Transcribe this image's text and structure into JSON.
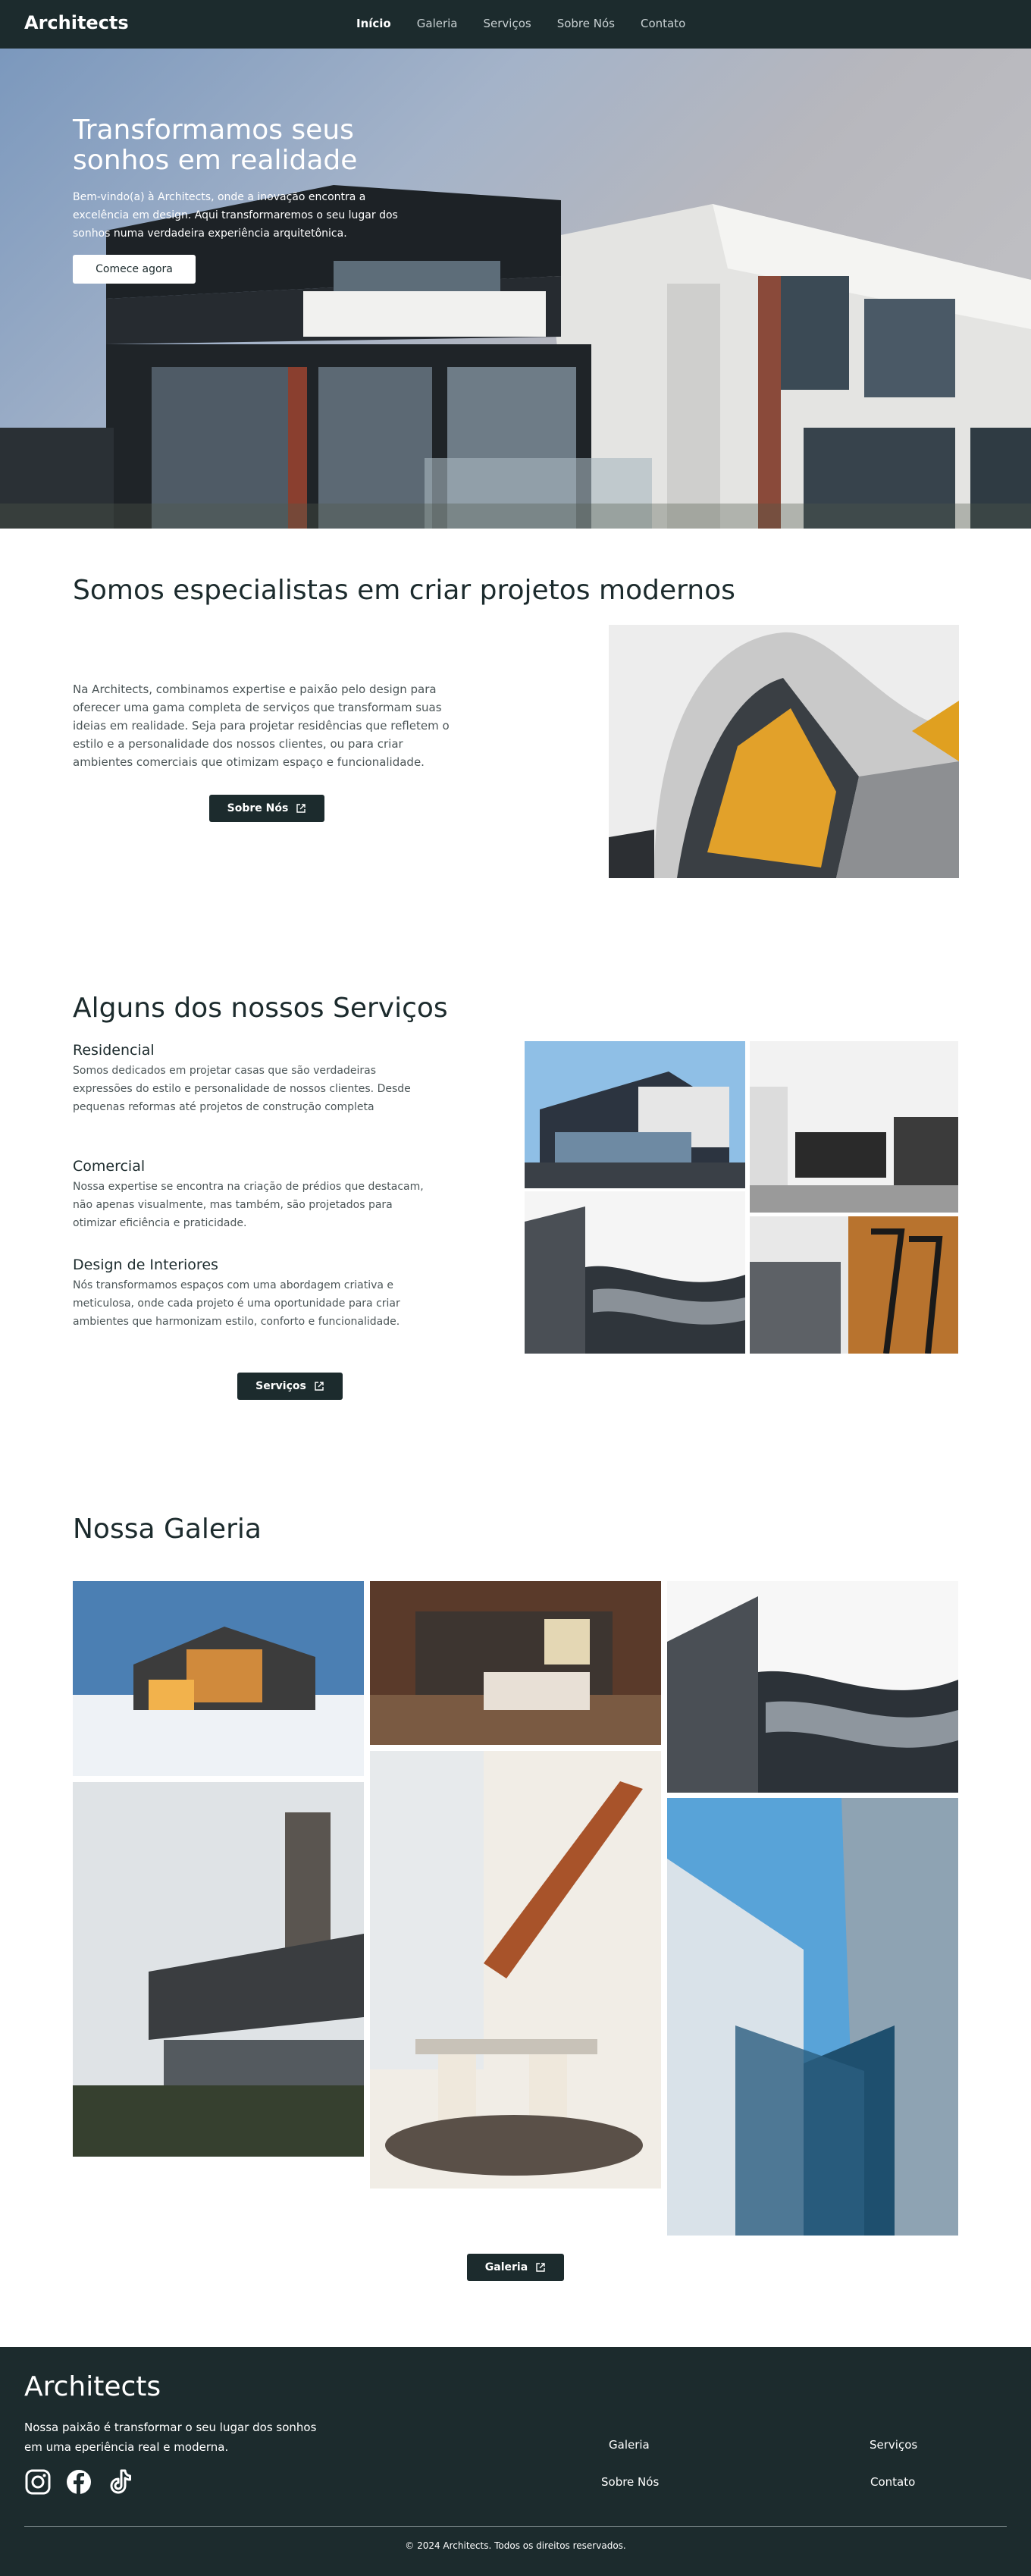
{
  "nav": {
    "brand": "Architects",
    "links": [
      "Início",
      "Galeria",
      "Serviços",
      "Sobre Nós",
      "Contato"
    ]
  },
  "hero": {
    "title": "Transformamos seus sonhos em realidade",
    "text": "Bem-vindo(a) à Architects, onde a inovação encontra a excelência em design. Aqui transformaremos o seu lugar dos sonhos numa verdadeira experiência arquitetônica.",
    "cta": "Comece agora"
  },
  "about": {
    "title": "Somos especialistas em criar projetos modernos",
    "text": "Na Architects, combinamos expertise e paixão pelo design para oferecer uma gama completa de serviços que transformam suas ideias em realidade. Seja para projetar residências que refletem o estilo e a personalidade dos nossos clientes, ou para criar ambientes comerciais que otimizam espaço e funcionalidade.",
    "button": "Sobre Nós"
  },
  "services": {
    "title": "Alguns dos nossos Serviços",
    "items": [
      {
        "title": "Residencial",
        "text": "Somos dedicados em projetar casas que são verdadeiras expressões do estilo e personalidade de nossos clientes. Desde pequenas reformas até projetos de construção completa"
      },
      {
        "title": "Comercial",
        "text": "Nossa expertise se encontra na criação de prédios que destacam, não apenas visualmente, mas também, são projetados para otimizar eficiência e praticidade."
      },
      {
        "title": "Design de Interiores",
        "text": "Nós transformamos espaços com uma abordagem criativa e meticulosa, onde cada projeto é uma oportunidade para criar ambientes que harmonizam estilo, conforto e funcionalidade."
      }
    ],
    "button": "Serviços"
  },
  "gallery": {
    "title": "Nossa Galeria",
    "button": "Galeria"
  },
  "footer": {
    "brand": "Architects",
    "tagline": "Nossa paixão é transformar o seu lugar dos sonhos em uma eperiência real e moderna.",
    "links": [
      "Galeria",
      "Serviços",
      "Sobre Nós",
      "Contato"
    ],
    "social_icons": [
      "instagram-icon",
      "facebook-icon",
      "tiktok-icon"
    ],
    "copyright": "© 2024 Architects. Todos os direitos reservados."
  },
  "colors": {
    "primary": "#1c2b2d",
    "text_muted": "#4b5557",
    "white": "#ffffff"
  }
}
